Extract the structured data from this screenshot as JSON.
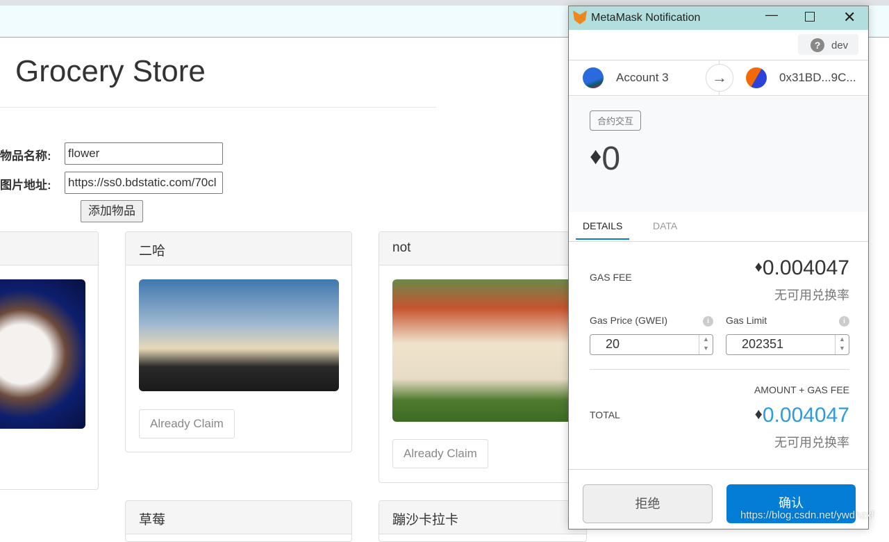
{
  "page": {
    "title": "Grocery Store",
    "name_label": "物品名称:",
    "name_value": "flower",
    "url_label": "图片地址:",
    "url_value": "https://ss0.bdstatic.com/70cl",
    "add_button": "添加物品"
  },
  "cards": [
    {
      "title": "",
      "button": ""
    },
    {
      "title": "二哈",
      "button": "Already Claim"
    },
    {
      "title": "not",
      "button": "Already Claim"
    },
    {
      "title": "草莓"
    },
    {
      "title": "蹦沙卡拉卡"
    }
  ],
  "metamask": {
    "window_title": "MetaMask Notification",
    "network": "dev",
    "from_account": "Account 3",
    "to_address": "0x31BD...9C...",
    "tx_type": "合约交互",
    "amount": "0",
    "tabs": [
      "DETAILS",
      "DATA"
    ],
    "active_tab": "DETAILS",
    "gas_fee_label": "GAS FEE",
    "gas_fee": "0.004047",
    "no_rate": "无可用兑换率",
    "gas_price_label": "Gas Price (GWEI)",
    "gas_price": "20",
    "gas_limit_label": "Gas Limit",
    "gas_limit": "202351",
    "amount_gas_label": "AMOUNT + GAS FEE",
    "total_label": "TOTAL",
    "total": "0.004047",
    "reject": "拒绝",
    "confirm": "确认",
    "accent": "#037dd6"
  },
  "watermark": "https://blog.csdn.net/ywdhzxf"
}
